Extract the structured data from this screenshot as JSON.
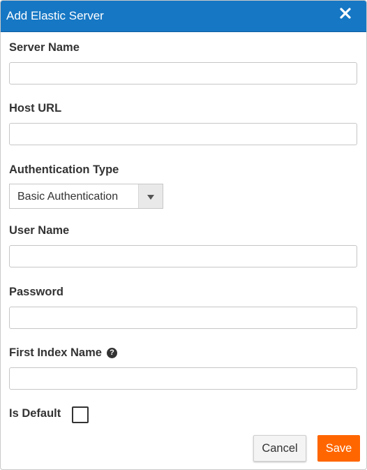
{
  "dialog": {
    "title": "Add Elastic Server",
    "close_icon": "close-icon"
  },
  "form": {
    "server_name": {
      "label": "Server Name",
      "value": ""
    },
    "host_url": {
      "label": "Host URL",
      "value": ""
    },
    "auth_type": {
      "label": "Authentication Type",
      "selected": "Basic Authentication"
    },
    "user_name": {
      "label": "User Name",
      "value": ""
    },
    "password": {
      "label": "Password",
      "value": ""
    },
    "first_index_name": {
      "label": "First Index Name",
      "value": "",
      "help_icon": "question-circle-icon",
      "help_glyph": "?"
    },
    "is_default": {
      "label": "Is Default",
      "checked": false
    }
  },
  "buttons": {
    "cancel": "Cancel",
    "save": "Save"
  },
  "colors": {
    "titlebar": "#1677c4",
    "save_button": "#ff6600"
  }
}
